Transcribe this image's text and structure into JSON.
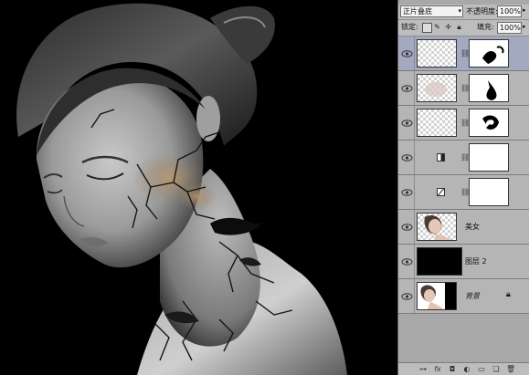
{
  "layers_panel": {
    "blend_mode": "正片叠底",
    "opacity_label": "不透明度:",
    "opacity_value": "100%",
    "lock_label": "锁定:",
    "fill_label": "填充:",
    "fill_value": "100%",
    "layers": [
      {
        "name": "",
        "kind": "pixel-with-mask",
        "visible": true,
        "selected": true
      },
      {
        "name": "",
        "kind": "pixel-with-mask",
        "visible": true,
        "selected": false
      },
      {
        "name": "",
        "kind": "pixel-with-mask",
        "visible": true,
        "selected": false
      },
      {
        "name": "",
        "kind": "adjustment-levels",
        "visible": true,
        "selected": false
      },
      {
        "name": "",
        "kind": "adjustment-curves",
        "visible": true,
        "selected": false
      },
      {
        "name": "美女",
        "kind": "pixel",
        "visible": true,
        "selected": false
      },
      {
        "name": "图层 2",
        "kind": "pixel",
        "visible": true,
        "selected": false
      },
      {
        "name": "背景",
        "kind": "background",
        "visible": true,
        "selected": false,
        "locked": true
      }
    ],
    "footer_icons": [
      "link-icon",
      "fx-icon",
      "add-mask-icon",
      "adjustment-icon",
      "group-icon",
      "new-layer-icon",
      "trash-icon"
    ]
  },
  "colors": {
    "panel_bg": "#a8a8a8",
    "selected_row": "#a3a9bf",
    "canvas_bg": "#000000"
  }
}
